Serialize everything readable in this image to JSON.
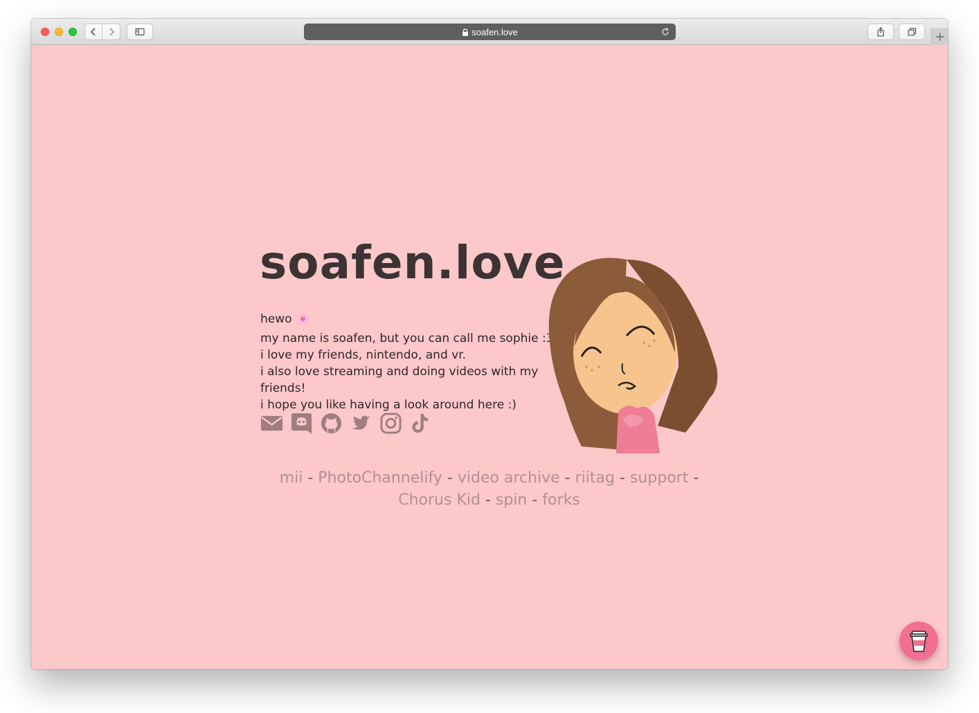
{
  "browser": {
    "url": "soafen.love",
    "icons": {
      "back": "chevron-left-icon",
      "forward": "chevron-right-icon",
      "sidebar": "sidebar-icon",
      "lock": "lock-icon",
      "reload": "reload-icon",
      "share": "share-icon",
      "tabs": "tabs-icon",
      "new_tab": "plus-icon"
    },
    "new_tab_glyph": "+"
  },
  "site": {
    "title": "soafen.love",
    "greeting": "hewo 🌸",
    "lines": [
      "my name is soafen, but you can call me sophie :3",
      "i love my friends, nintendo, and vr.",
      "i also love streaming and doing videos with my friends!",
      "i hope you like having a look around here :)"
    ]
  },
  "socials": [
    "email-icon",
    "discord-icon",
    "github-icon",
    "twitter-icon",
    "instagram-icon",
    "tiktok-icon"
  ],
  "links": {
    "items": [
      "mii",
      "PhotoChannelify",
      "video archive",
      "riitag",
      "support",
      "Chorus Kid",
      "spin",
      "forks"
    ],
    "separator": " - "
  },
  "colors": {
    "background": "#fdc8ca",
    "title": "#3c3334",
    "link": "#b38f91",
    "coffee_button": "#f26f92"
  },
  "coffee_button": "coffee-cup-icon"
}
